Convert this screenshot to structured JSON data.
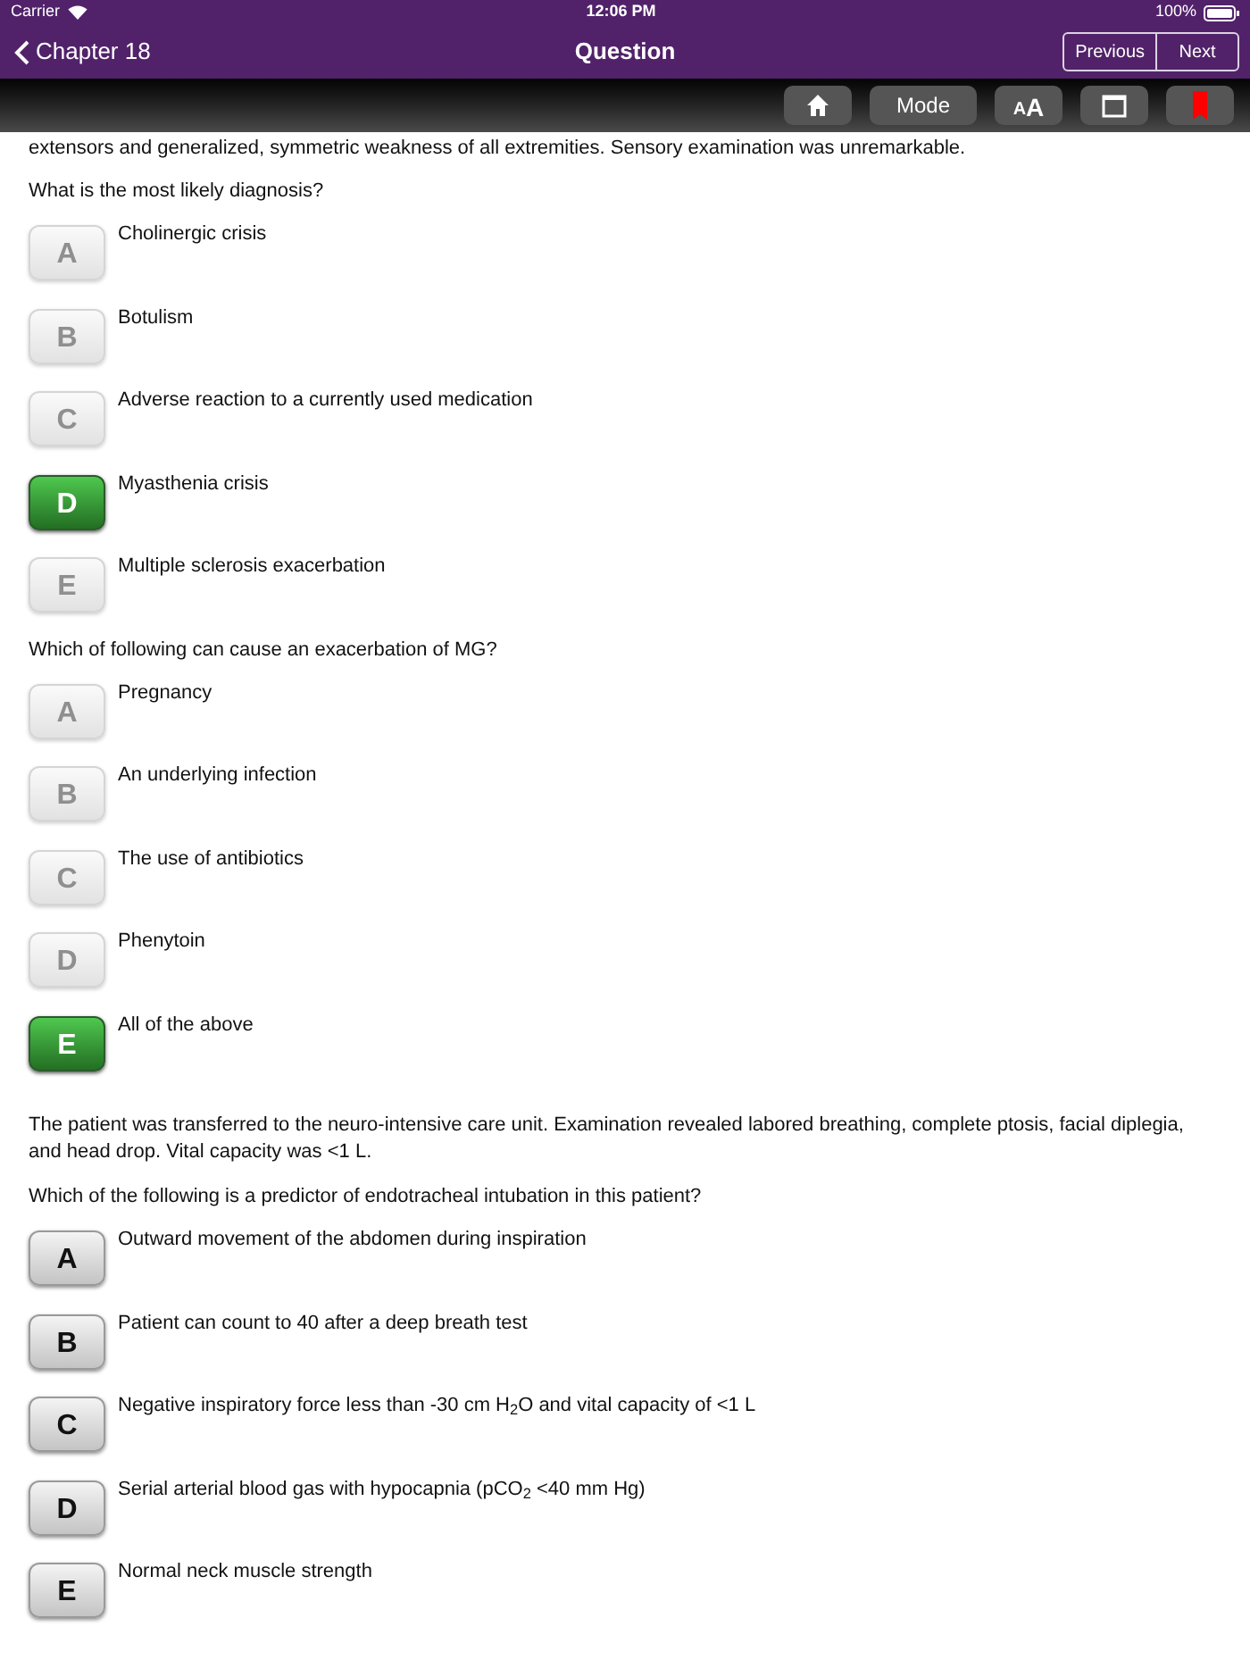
{
  "status_bar": {
    "carrier": "Carrier",
    "time": "12:06 PM",
    "battery": "100%"
  },
  "nav_bar": {
    "back": "Chapter 18",
    "title": "Question",
    "buttons": [
      "Previous",
      "Next"
    ]
  },
  "toolbar": {
    "mode": "Mode",
    "font_size": "AA"
  },
  "sections": [
    {
      "stem": "extensors and generalized, symmetric weakness of all extremities. Sensory examination was unremarkable.",
      "question": "What is the most likely diagnosis?",
      "choices": [
        {
          "letter": "A",
          "text": "Cholinergic crisis",
          "disabled": true,
          "selected": false
        },
        {
          "letter": "B",
          "text": "Botulism",
          "disabled": true,
          "selected": false
        },
        {
          "letter": "C",
          "text": "Adverse reaction to a currently used medication",
          "disabled": true,
          "selected": false
        },
        {
          "letter": "D",
          "text": "Myasthenia crisis",
          "disabled": true,
          "selected": true
        },
        {
          "letter": "E",
          "text": "Multiple sclerosis exacerbation",
          "disabled": true,
          "selected": false
        }
      ]
    },
    {
      "question": "Which of following can cause an exacerbation of MG?",
      "choices": [
        {
          "letter": "A",
          "text": "Pregnancy",
          "disabled": true,
          "selected": false
        },
        {
          "letter": "B",
          "text": "An underlying infection",
          "disabled": true,
          "selected": false
        },
        {
          "letter": "C",
          "text": "The use of antibiotics",
          "disabled": true,
          "selected": false
        },
        {
          "letter": "D",
          "text": "Phenytoin",
          "disabled": true,
          "selected": false
        },
        {
          "letter": "E",
          "text": "All of the above",
          "disabled": true,
          "selected": true
        }
      ]
    },
    {
      "stem": "The patient was transferred to the neuro-intensive care unit. Examination revealed labored breathing, complete ptosis, facial diplegia, and head drop. Vital capacity was <1 L.",
      "question": "Which of the following is a predictor of endotracheal intubation in this patient?",
      "choices": [
        {
          "letter": "A",
          "text": "Outward movement of the abdomen during inspiration",
          "disabled": false,
          "selected": false
        },
        {
          "letter": "B",
          "text": "Patient can count to 40 after a deep breath test",
          "disabled": false,
          "selected": false
        },
        {
          "letter": "C",
          "text": "Negative inspiratory force less than -30 cm H$_{2}$O and vital capacity of <1 L",
          "disabled": false,
          "selected": false
        },
        {
          "letter": "D",
          "text": "Serial arterial blood gas with hypocapnia (pCO$_{2}$ <40 mm Hg)",
          "disabled": false,
          "selected": false
        },
        {
          "letter": "E",
          "text": "Normal neck muscle strength",
          "disabled": false,
          "selected": false
        }
      ]
    }
  ]
}
